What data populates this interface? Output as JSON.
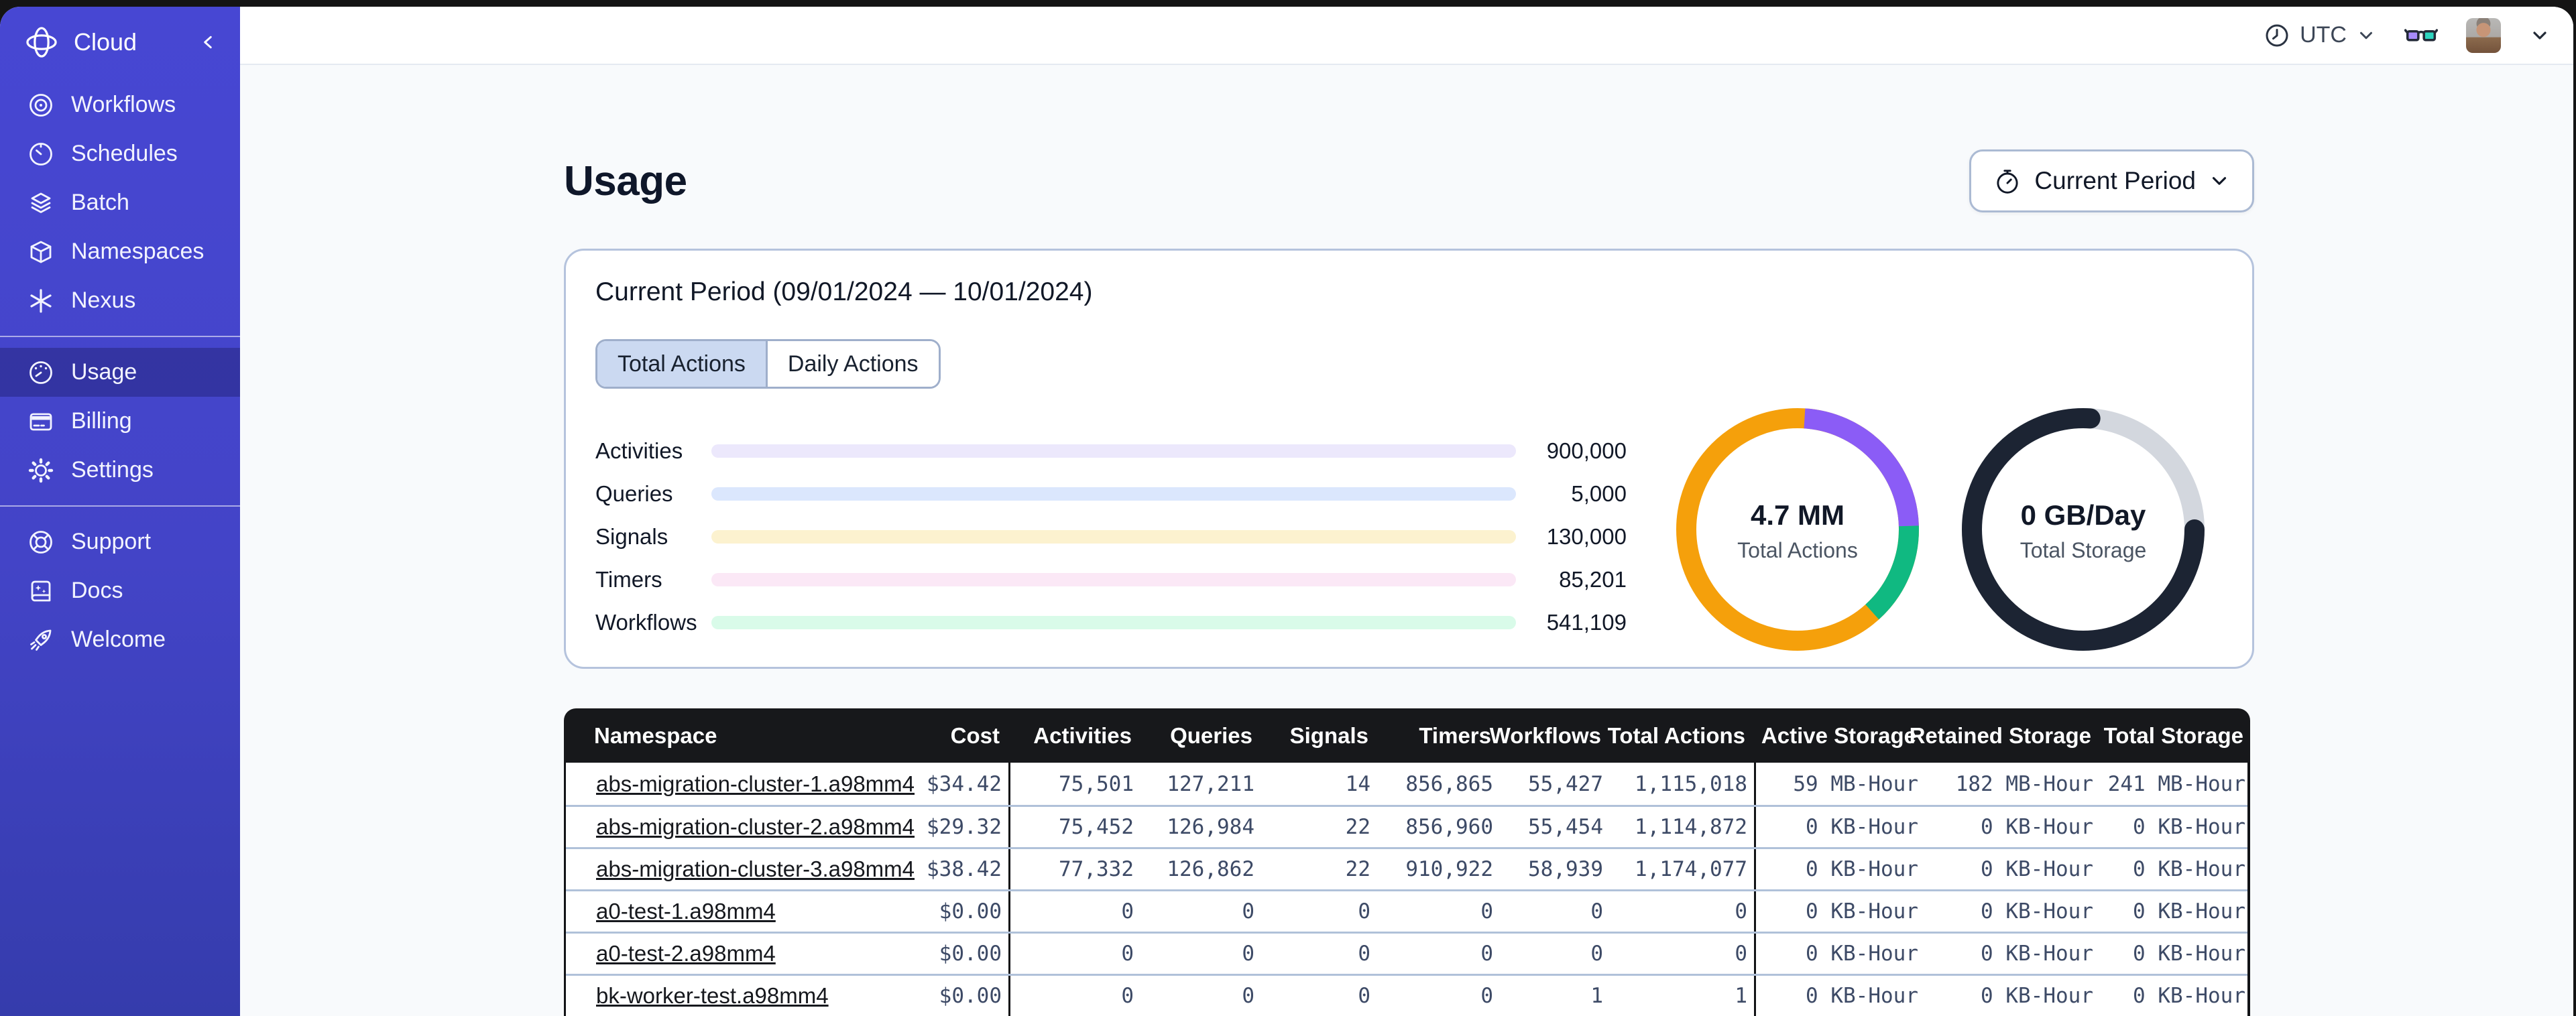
{
  "sidebar": {
    "brand": {
      "label": "Cloud",
      "logo_icon": "temporal-logo",
      "collapse_icon": "chevron-left-icon"
    },
    "groups": [
      {
        "items": [
          {
            "icon": "workflows-icon",
            "label": "Workflows",
            "active": false
          },
          {
            "icon": "schedules-icon",
            "label": "Schedules",
            "active": false
          },
          {
            "icon": "batch-icon",
            "label": "Batch",
            "active": false
          },
          {
            "icon": "namespaces-icon",
            "label": "Namespaces",
            "active": false
          },
          {
            "icon": "nexus-icon",
            "label": "Nexus",
            "active": false
          }
        ]
      },
      {
        "items": [
          {
            "icon": "usage-gauge-icon",
            "label": "Usage",
            "active": true
          },
          {
            "icon": "billing-icon",
            "label": "Billing",
            "active": false
          },
          {
            "icon": "settings-icon",
            "label": "Settings",
            "active": false
          }
        ]
      },
      {
        "items": [
          {
            "icon": "support-icon",
            "label": "Support",
            "active": false
          },
          {
            "icon": "docs-icon",
            "label": "Docs",
            "active": false
          },
          {
            "icon": "welcome-icon",
            "label": "Welcome",
            "active": false
          }
        ]
      }
    ]
  },
  "topbar": {
    "timezone": {
      "icon": "clock-icon",
      "label": "UTC",
      "chevron": "chevron-down-icon"
    },
    "glasses_icon": "glasses-icon",
    "avatar": "user-avatar",
    "avatar_chevron": "chevron-down-icon"
  },
  "page": {
    "title": "Usage",
    "period_button": {
      "icon": "stopwatch-icon",
      "label": "Current Period"
    }
  },
  "usage_card": {
    "title": "Current Period (09/01/2024 — 10/01/2024)",
    "tabs": [
      {
        "label": "Total Actions",
        "active": true
      },
      {
        "label": "Daily Actions",
        "active": false
      }
    ]
  },
  "chart_data": [
    {
      "id": "usage-bars",
      "type": "bar",
      "orientation": "horizontal",
      "categories": [
        "Activities",
        "Queries",
        "Signals",
        "Timers",
        "Workflows"
      ],
      "values": [
        900000,
        5000,
        130000,
        85201,
        541109
      ],
      "bars": [
        {
          "label": "Activities",
          "value": 900000,
          "value_label": "900,000",
          "fraction_pct": "88.5%",
          "color": "#8B5CF6",
          "track_color": "#ECE8FC"
        },
        {
          "label": "Queries",
          "value": 5000,
          "value_label": "5,000",
          "fraction_pct": "6.5%",
          "color": "#4285F4",
          "track_color": "#DBE7FD"
        },
        {
          "label": "Signals",
          "value": 130000,
          "value_label": "130,000",
          "fraction_pct": "26%",
          "color": "#F2A20D",
          "track_color": "#FCF2CF"
        },
        {
          "label": "Timers",
          "value": 85201,
          "value_label": "85,201",
          "fraction_pct": "15.2%",
          "color": "#E5488F",
          "track_color": "#FBE8F6"
        },
        {
          "label": "Workflows",
          "value": 541109,
          "value_label": "541,109",
          "fraction_pct": "44%",
          "color": "#12B488",
          "track_color": "#D9FBE9"
        }
      ]
    },
    {
      "id": "total-actions-donut",
      "type": "donut",
      "center_value": "4.7 MM",
      "center_label": "Total Actions",
      "base_color": "#F5A00B",
      "segments": [
        {
          "name": "purple-segment",
          "color": "#8B5CF6",
          "start_pct": 1,
          "length_pct": 23.5,
          "cap": "butt"
        },
        {
          "name": "green-segment",
          "color": "#10B981",
          "start_pct": 24.5,
          "length_pct": 13.8,
          "cap": "butt"
        }
      ]
    },
    {
      "id": "total-storage-donut",
      "type": "donut",
      "center_value": "0 GB/Day",
      "center_label": "Total Storage",
      "base_color": "#D3D7DE",
      "segments": [
        {
          "name": "dark-segment",
          "color": "#1C2433",
          "start_pct": 25,
          "length_pct": 76,
          "cap": "round"
        }
      ]
    }
  ],
  "table": {
    "columns": [
      "Namespace",
      "Cost",
      "Activities",
      "Queries",
      "Signals",
      "Timers",
      "Workflows",
      "Total Actions",
      "Active Storage",
      "Retained Storage",
      "Total Storage"
    ],
    "rows": [
      {
        "namespace": "abs-migration-cluster-1.a98mm4",
        "cost": "$34.42",
        "activities": "75,501",
        "queries": "127,211",
        "signals": "14",
        "timers": "856,865",
        "workflows": "55,427",
        "total_actions": "1,115,018",
        "active_storage": "59 MB-Hour",
        "retained_storage": "182 MB-Hour",
        "total_storage": "241 MB-Hour"
      },
      {
        "namespace": "abs-migration-cluster-2.a98mm4",
        "cost": "$29.32",
        "activities": "75,452",
        "queries": "126,984",
        "signals": "22",
        "timers": "856,960",
        "workflows": "55,454",
        "total_actions": "1,114,872",
        "active_storage": "0 KB-Hour",
        "retained_storage": "0 KB-Hour",
        "total_storage": "0 KB-Hour"
      },
      {
        "namespace": "abs-migration-cluster-3.a98mm4",
        "cost": "$38.42",
        "activities": "77,332",
        "queries": "126,862",
        "signals": "22",
        "timers": "910,922",
        "workflows": "58,939",
        "total_actions": "1,174,077",
        "active_storage": "0 KB-Hour",
        "retained_storage": "0 KB-Hour",
        "total_storage": "0 KB-Hour"
      },
      {
        "namespace": "a0-test-1.a98mm4",
        "cost": "$0.00",
        "activities": "0",
        "queries": "0",
        "signals": "0",
        "timers": "0",
        "workflows": "0",
        "total_actions": "0",
        "active_storage": "0 KB-Hour",
        "retained_storage": "0 KB-Hour",
        "total_storage": "0 KB-Hour"
      },
      {
        "namespace": "a0-test-2.a98mm4",
        "cost": "$0.00",
        "activities": "0",
        "queries": "0",
        "signals": "0",
        "timers": "0",
        "workflows": "0",
        "total_actions": "0",
        "active_storage": "0 KB-Hour",
        "retained_storage": "0 KB-Hour",
        "total_storage": "0 KB-Hour"
      },
      {
        "namespace": "bk-worker-test.a98mm4",
        "cost": "$0.00",
        "activities": "0",
        "queries": "0",
        "signals": "0",
        "timers": "0",
        "workflows": "1",
        "total_actions": "1",
        "active_storage": "0 KB-Hour",
        "retained_storage": "0 KB-Hour",
        "total_storage": "0 KB-Hour"
      }
    ]
  }
}
